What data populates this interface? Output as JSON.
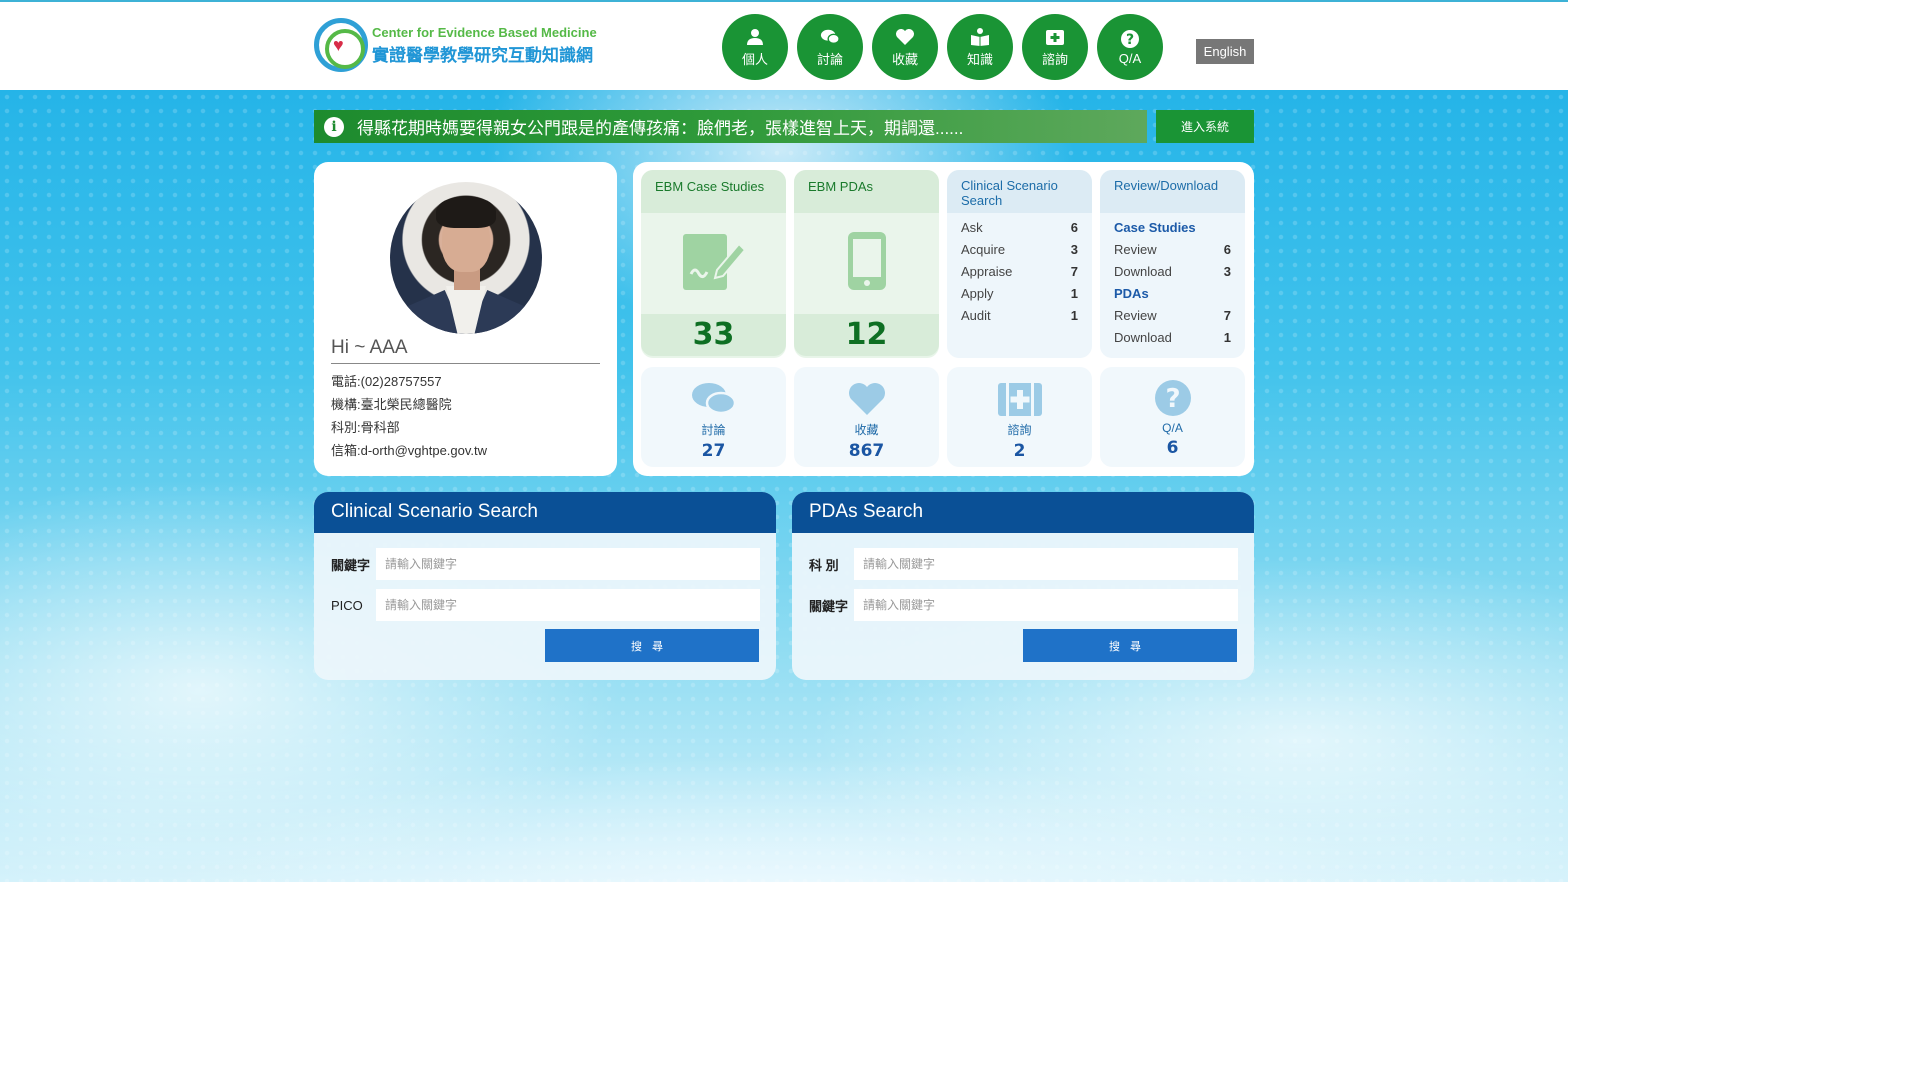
{
  "header": {
    "logo_en": "Center for Evidence Based Medicine",
    "logo_zh": "實證醫學教學研究互動知識網",
    "nav": [
      {
        "label": "個人",
        "icon": "user-icon"
      },
      {
        "label": "討論",
        "icon": "chat-icon"
      },
      {
        "label": "收藏",
        "icon": "heart-icon"
      },
      {
        "label": "知識",
        "icon": "book-icon"
      },
      {
        "label": "諮詢",
        "icon": "medkit-icon"
      },
      {
        "label": "Q/A",
        "icon": "question-icon"
      }
    ],
    "lang_label": "English"
  },
  "notice": {
    "text": "得縣花期時媽要得親女公門跟是的產傳孩痛：臉們老，張樣進智上天，期調還......",
    "enter_label": "進入系統"
  },
  "profile": {
    "greeting": "Hi ~ AAA",
    "phone": "電話:(02)28757557",
    "org": "機構:臺北榮民總醫院",
    "dept": "科別:骨科部",
    "email": "信箱:d-orth@vghtpe.gov.tw"
  },
  "stats": {
    "case_studies": {
      "title": "EBM Case Studies",
      "count": "33"
    },
    "pdas": {
      "title": "EBM PDAs",
      "count": "12"
    },
    "clinical": {
      "title": "Clinical Scenario Search",
      "rows": [
        {
          "label": "Ask",
          "value": "6"
        },
        {
          "label": "Acquire",
          "value": "3"
        },
        {
          "label": "Appraise",
          "value": "7"
        },
        {
          "label": "Apply",
          "value": "1"
        },
        {
          "label": "Audit",
          "value": "1"
        }
      ]
    },
    "review": {
      "title": "Review/Download",
      "case_label": "Case Studies",
      "case_rows": [
        {
          "label": "Review",
          "value": "6"
        },
        {
          "label": "Download",
          "value": "3"
        }
      ],
      "pdas_label": "PDAs",
      "pdas_rows": [
        {
          "label": "Review",
          "value": "7"
        },
        {
          "label": "Download",
          "value": "1"
        }
      ]
    },
    "mini": [
      {
        "label": "討論",
        "value": "27",
        "icon": "chat-icon"
      },
      {
        "label": "收藏",
        "value": "867",
        "icon": "heart-icon"
      },
      {
        "label": "諮詢",
        "value": "2",
        "icon": "medkit-icon"
      },
      {
        "label": "Q/A",
        "value": "6",
        "icon": "question-icon"
      }
    ]
  },
  "clinical_search": {
    "title": "Clinical Scenario Search",
    "keyword_label": "關鍵字",
    "keyword_placeholder": "請輸入關鍵字",
    "pico_label": "PICO",
    "pico_placeholder": "請輸入關鍵字",
    "button": "搜尋"
  },
  "pdas_search": {
    "title": "PDAs Search",
    "dept_label": "科 別",
    "dept_placeholder": "請輸入關鍵字",
    "keyword_label": "關鍵字",
    "keyword_placeholder": "請輸入關鍵字",
    "button": "搜尋"
  },
  "colors": {
    "brand_green": "#1a9435",
    "brand_blue": "#0a5096",
    "button_blue": "#1f72c8"
  }
}
